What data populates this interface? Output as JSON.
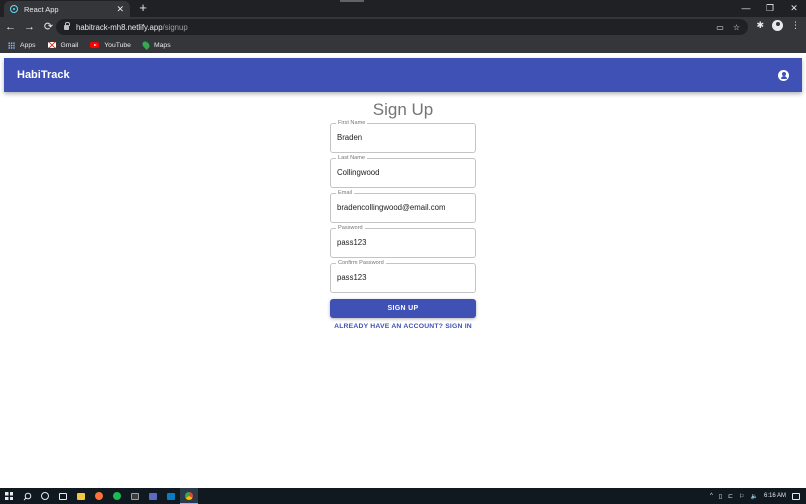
{
  "browser": {
    "tab_title": "React App",
    "tab_close": "✕",
    "new_tab": "+",
    "url_host": "habitrack-mh8.netlify.app",
    "url_path": "/signup",
    "window_controls": [
      "—",
      "❐",
      "✕"
    ],
    "nav": {
      "back": "←",
      "forward": "→",
      "reload": "⟳"
    },
    "omnibox_icons": [
      "▭",
      "☆"
    ],
    "toolbar_icons": [
      "✱",
      "⋮"
    ]
  },
  "bookmarks": [
    {
      "label": "Apps",
      "icon": "apps-grid-icon"
    },
    {
      "label": "Gmail",
      "icon": "gmail-icon"
    },
    {
      "label": "YouTube",
      "icon": "youtube-icon"
    },
    {
      "label": "Maps",
      "icon": "maps-icon"
    }
  ],
  "app": {
    "brand": "HabiTrack",
    "accent": "#3f51b5"
  },
  "form": {
    "title": "Sign Up",
    "fields": [
      {
        "label": "First Name",
        "value": "Braden"
      },
      {
        "label": "Last Name",
        "value": "Collingwood"
      },
      {
        "label": "Email",
        "value": "bradencollingwood@email.com"
      },
      {
        "label": "Password",
        "value": "pass123"
      },
      {
        "label": "Confirm Password",
        "value": "pass123"
      }
    ],
    "submit_label": "SIGN UP",
    "signin_link": "ALREADY HAVE AN ACCOUNT? SIGN IN"
  },
  "taskbar": {
    "tray_symbols": [
      "^",
      "▯",
      "⊏",
      "⚐",
      "🔈"
    ],
    "time": "6:16 AM"
  }
}
